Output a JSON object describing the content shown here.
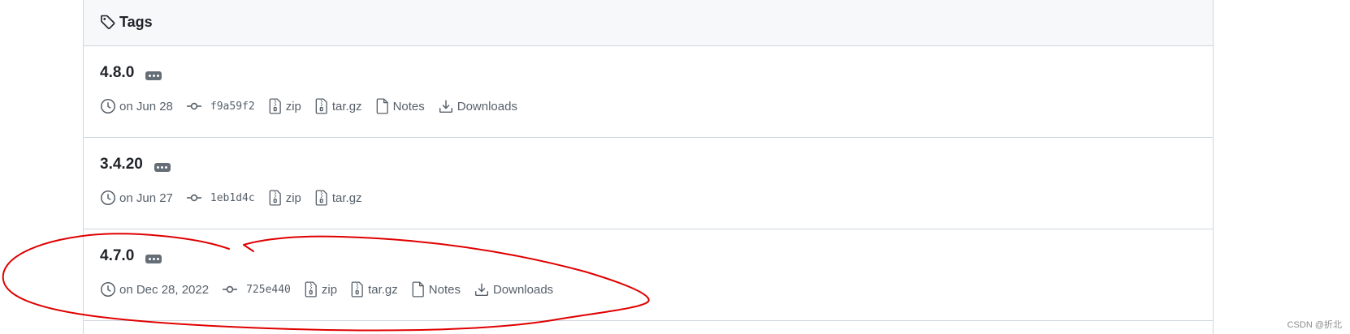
{
  "header": {
    "title": "Tags"
  },
  "tags": [
    {
      "name": "4.8.0",
      "date": "on Jun 28",
      "commit": "f9a59f2",
      "zip_label": "zip",
      "targz_label": "tar.gz",
      "notes_label": "Notes",
      "downloads_label": "Downloads"
    },
    {
      "name": "3.4.20",
      "date": "on Jun 27",
      "commit": "1eb1d4c",
      "zip_label": "zip",
      "targz_label": "tar.gz"
    },
    {
      "name": "4.7.0",
      "date": "on Dec 28, 2022",
      "commit": "725e440",
      "zip_label": "zip",
      "targz_label": "tar.gz",
      "notes_label": "Notes",
      "downloads_label": "Downloads"
    }
  ],
  "watermark": "CSDN @折北",
  "colors": {
    "border": "#d0d7de",
    "header_bg": "#f6f8fa",
    "muted_text": "#57606a",
    "annotation_red": "#e00000"
  }
}
